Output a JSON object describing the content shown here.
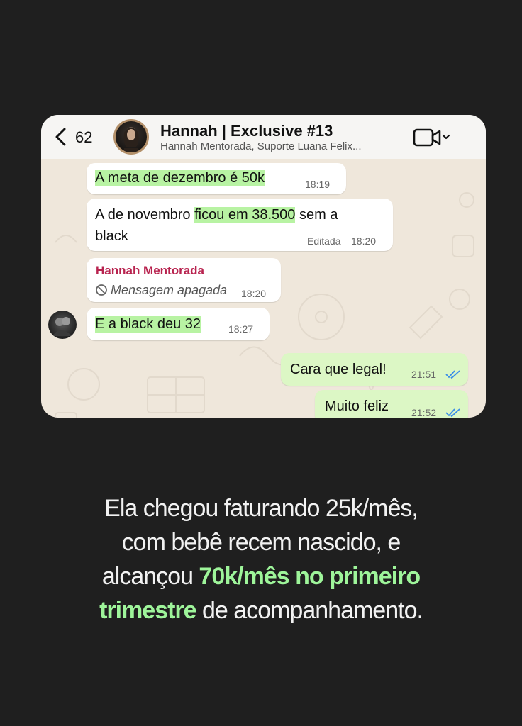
{
  "header": {
    "unread_count": "62",
    "title": "Hannah | Exclusive #13",
    "subtitle": "Hannah Mentorada, Suporte Luana Felix..."
  },
  "messages": [
    {
      "text": "A meta de dezembro é 50k",
      "time": "18:19"
    },
    {
      "line1_a": "A de novembro ",
      "line1_b": "ficou em 38.500",
      "line1_c": " sem a",
      "line2": "black",
      "edited": "Editada",
      "time": "18:20"
    },
    {
      "sender": "Hannah Mentorada",
      "deleted_text": "Mensagem apagada",
      "time": "18:20"
    },
    {
      "text": "E a black deu 32",
      "time": "18:27"
    },
    {
      "text": "Cara que legal!",
      "time": "21:51"
    },
    {
      "text": "Muito feliz",
      "time": "21:52"
    }
  ],
  "caption": {
    "line1": "Ela chegou faturando 25k/mês,",
    "line2": "com bebê recem nascido, e",
    "line3_a": "alcançou ",
    "line3_b": "70k/mês no primeiro",
    "line4_a": "trimestre",
    "line4_b": " de acompanhamento."
  },
  "icons": {
    "back": "chevron-left-icon",
    "video": "video-call-icon",
    "deleted": "blocked-circle-icon",
    "read": "double-check-icon"
  },
  "colors": {
    "background": "#1f1f1f",
    "highlight": "#b8f3a3",
    "outgoing_bubble": "#dcf7c5",
    "sender_name": "#b8234f",
    "caption_accent": "#9ef59a",
    "read_ticks": "#3b8ee8"
  }
}
